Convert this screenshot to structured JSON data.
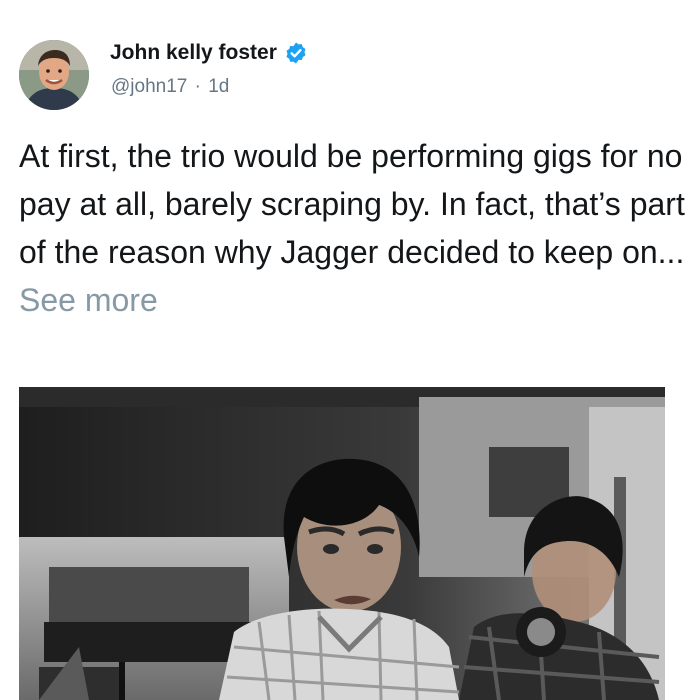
{
  "tweet": {
    "author": {
      "name": "John kelly foster",
      "handle": "@john17",
      "separator": "·",
      "age": "1d"
    },
    "text_main": "At first, the trio would be performing gigs for no pay at all, barely scraping by. In fact, that’s part of the reason why Jagger decided to keep on...",
    "see_more_label": "See more"
  },
  "icons": {
    "verified": "verified-badge-icon"
  },
  "colors": {
    "verified_blue": "#1da1f2",
    "secondary_text": "#657786",
    "see_more": "#8899a6"
  }
}
